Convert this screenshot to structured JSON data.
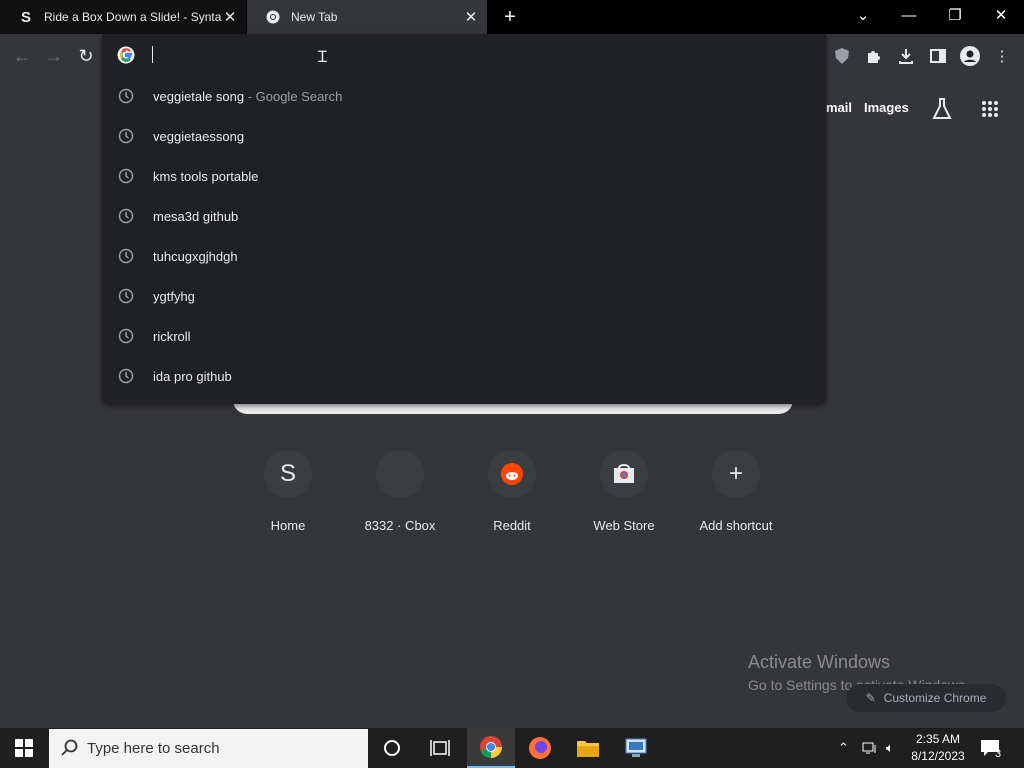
{
  "tabs": [
    {
      "title": "Ride a Box Down a Slide! - Syntax",
      "favicon": "S",
      "active": false
    },
    {
      "title": "New Tab",
      "active": true
    }
  ],
  "toolbar": {
    "omnibox_value": "",
    "extensions": [
      "ublock-icon",
      "puzzle-icon",
      "download-icon",
      "sidepanel-icon",
      "profile-icon",
      "menu-icon"
    ]
  },
  "ntp": {
    "gmail_label": "mail",
    "images_label": "Images",
    "shortcuts": [
      {
        "label": "Home",
        "icon": "S"
      },
      {
        "label": "8332 · Cbox",
        "icon": ""
      },
      {
        "label": "Reddit",
        "icon": "reddit"
      },
      {
        "label": "Web Store",
        "icon": "webstore"
      },
      {
        "label": "Add shortcut",
        "icon": "+"
      }
    ],
    "customize_label": "Customize Chrome"
  },
  "suggestions": [
    {
      "text": "veggietale song",
      "hint": " - Google Search"
    },
    {
      "text": "veggietaessong",
      "hint": ""
    },
    {
      "text": "kms tools portable",
      "hint": ""
    },
    {
      "text": "mesa3d github",
      "hint": ""
    },
    {
      "text": "tuhcugxgjhdgh",
      "hint": ""
    },
    {
      "text": "ygtfyhg",
      "hint": ""
    },
    {
      "text": "rickroll",
      "hint": ""
    },
    {
      "text": "ida pro github",
      "hint": ""
    }
  ],
  "watermark": {
    "line1": "Activate Windows",
    "line2": "Go to Settings to activate Windows."
  },
  "taskbar": {
    "search_placeholder": "Type here to search",
    "time": "2:35 AM",
    "date": "8/12/2023",
    "notification_count": "3"
  },
  "colors": {
    "tabstrip": "#000000",
    "surface": "#35363a",
    "dropdown": "#202124",
    "accent": "#76b9ed"
  }
}
